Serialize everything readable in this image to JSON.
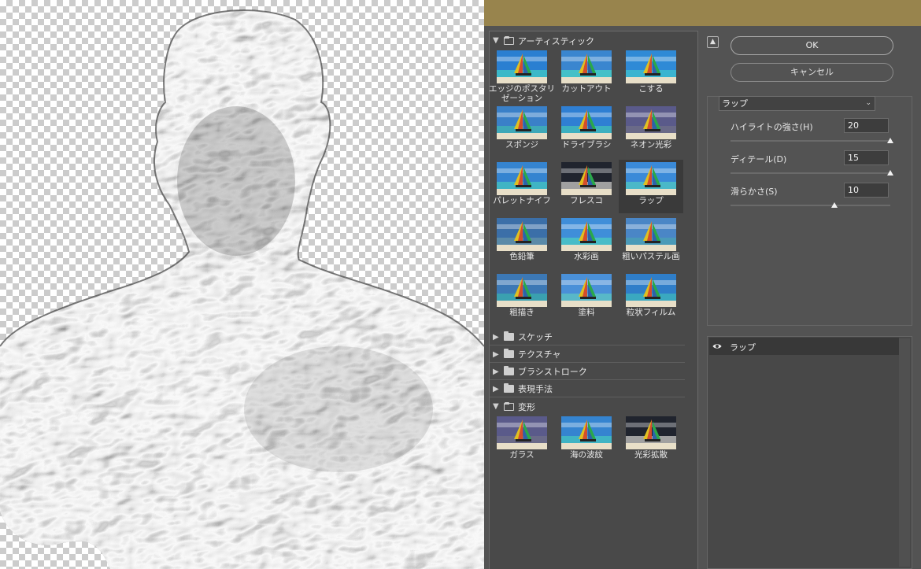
{
  "gallery": {
    "categories": [
      {
        "label": "アーティスティック",
        "expanded": true
      },
      {
        "label": "スケッチ",
        "expanded": false
      },
      {
        "label": "テクスチャ",
        "expanded": false
      },
      {
        "label": "ブラシストローク",
        "expanded": false
      },
      {
        "label": "表現手法",
        "expanded": false
      },
      {
        "label": "変形",
        "expanded": true
      }
    ],
    "artistic": [
      "エッジのポスタリゼーション",
      "カットアウト",
      "こする",
      "スポンジ",
      "ドライブラシ",
      "ネオン光彩",
      "パレットナイフ",
      "フレスコ",
      "ラップ",
      "色鉛筆",
      "水彩画",
      "粗いパステル画",
      "粗描き",
      "塗料",
      "粒状フィルム"
    ],
    "distort": [
      "ガラス",
      "海の波紋",
      "光彩拡散"
    ],
    "selected": "ラップ"
  },
  "buttons": {
    "ok": "OK",
    "cancel": "キャンセル"
  },
  "settings": {
    "filter": "ラップ",
    "params": [
      {
        "label": "ハイライトの強さ(H)",
        "value": "20",
        "fraction": 1.0
      },
      {
        "label": "ディテール(D)",
        "value": "15",
        "fraction": 1.0
      },
      {
        "label": "滑らかさ(S)",
        "value": "10",
        "fraction": 0.65
      }
    ]
  },
  "layers": {
    "items": [
      {
        "name": "ラップ",
        "visible": true
      }
    ]
  },
  "colors": {
    "titlebar": "#98844d",
    "panel": "#535353",
    "selected": "#3a3a3a"
  }
}
